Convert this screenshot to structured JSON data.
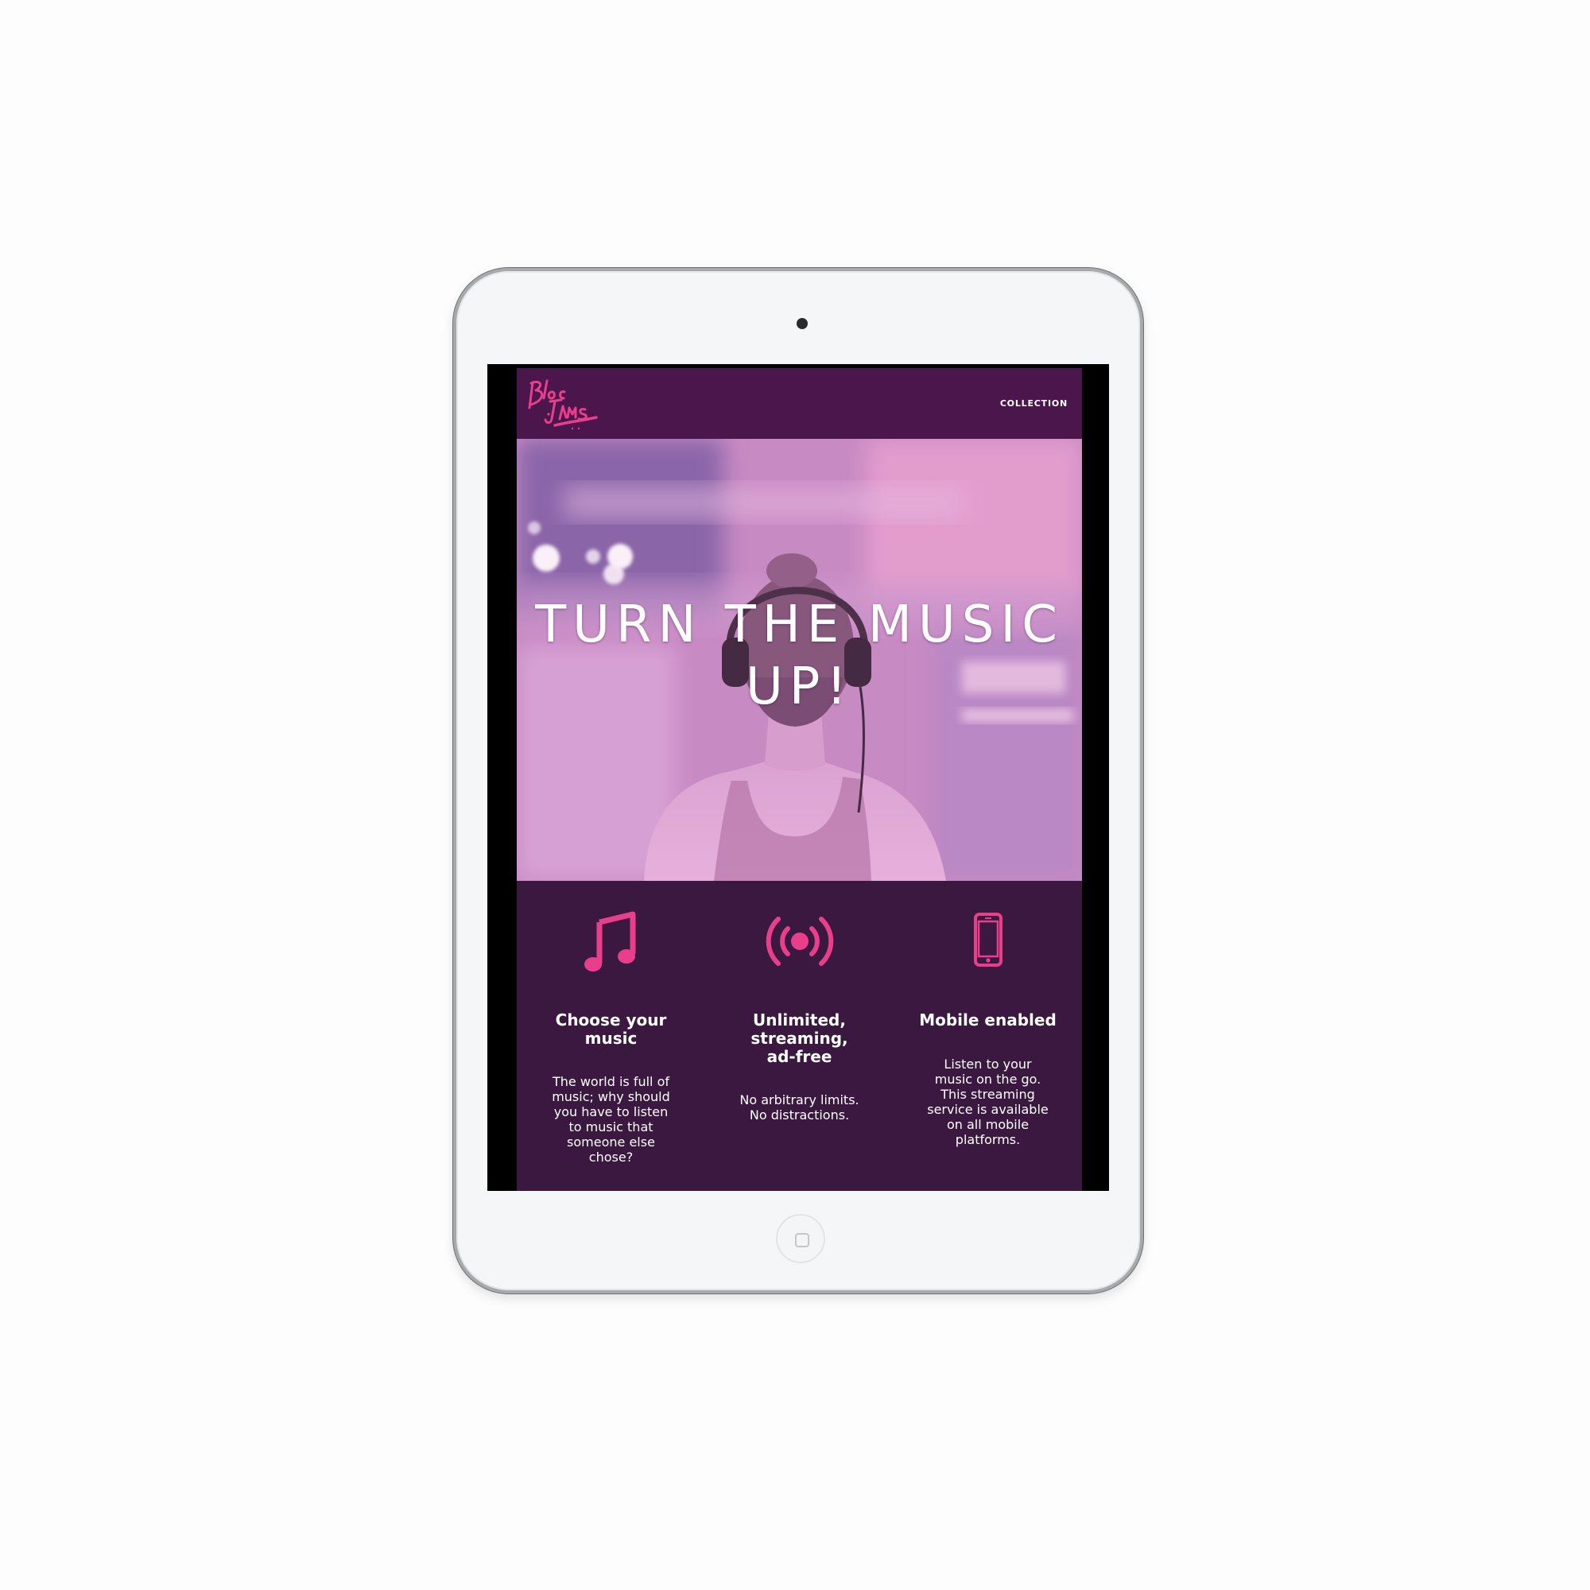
{
  "brand": {
    "logo_text": "Bloc Jams",
    "accent_color": "#e83e8c",
    "nav_background": "#4b164c",
    "page_background": "#3b1840"
  },
  "navbar": {
    "links": [
      {
        "label": "COLLECTION"
      }
    ]
  },
  "hero": {
    "title": "TURN THE MUSIC UP!"
  },
  "selling_points": [
    {
      "icon": "music-note-icon",
      "title": "Choose your music",
      "text": "The world is full of music; why should you have to listen to music that someone else chose?"
    },
    {
      "icon": "radio-broadcast-icon",
      "title": "Unlimited, streaming, ad-free",
      "text": "No arbitrary limits. No distractions."
    },
    {
      "icon": "mobile-phone-icon",
      "title": "Mobile enabled",
      "text": "Listen to your music on the go. This streaming service is available on all mobile platforms."
    }
  ]
}
